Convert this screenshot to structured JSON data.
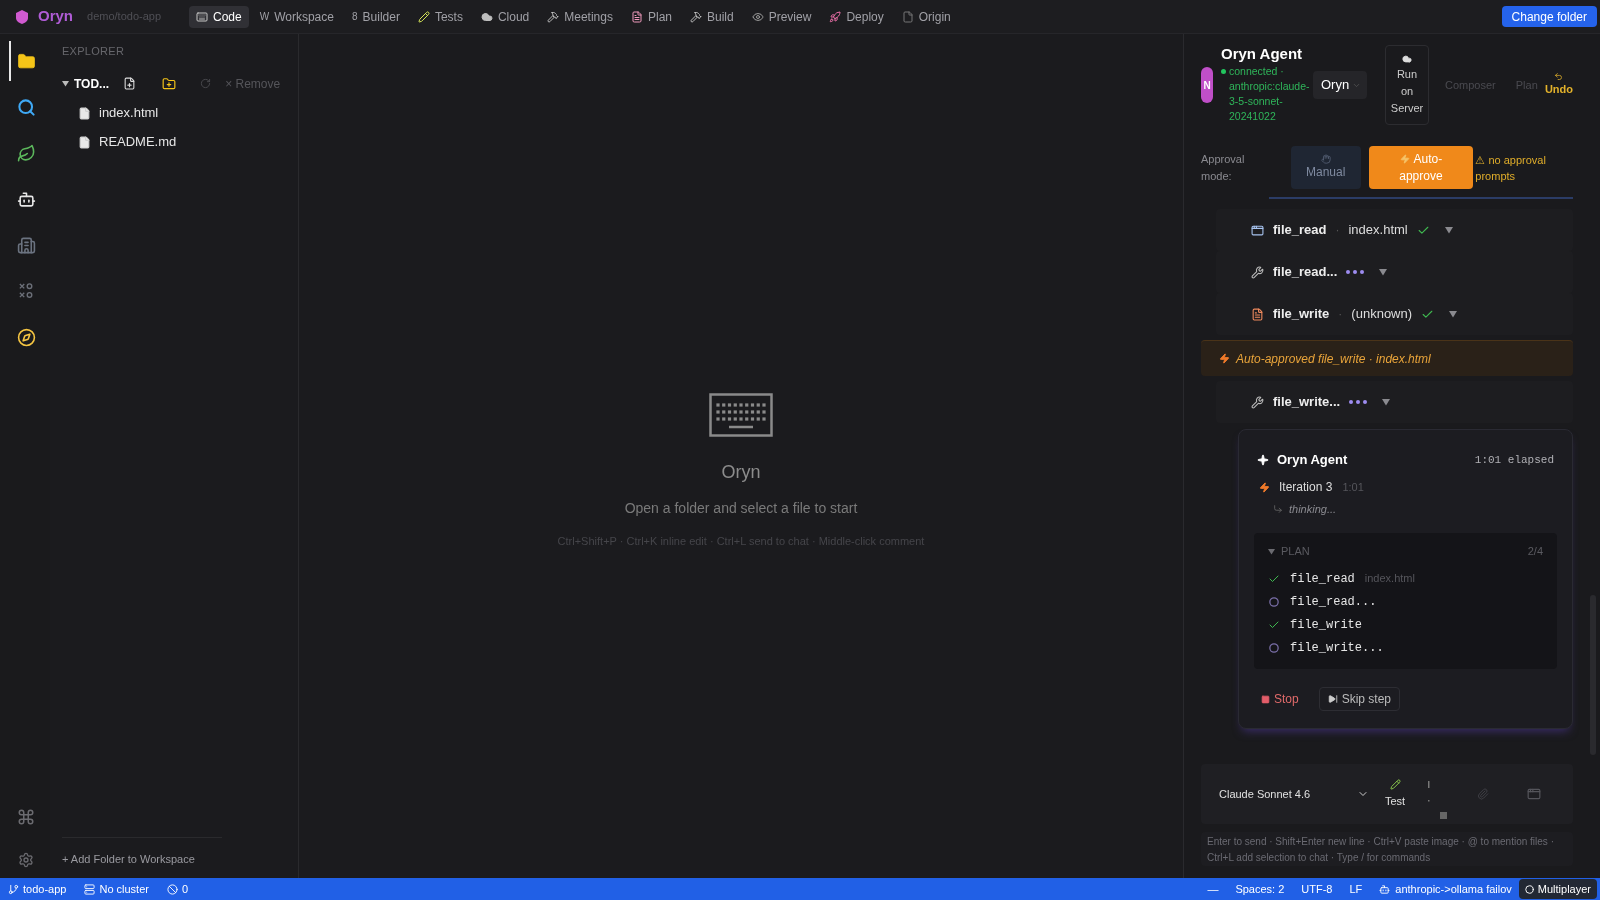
{
  "top_bar": {
    "app_name": "Oryn",
    "project_path": "demo/todo-app",
    "tabs": [
      {
        "label": "Code",
        "selected": true
      },
      {
        "glyph": "W",
        "label": "Workspace",
        "selected": false
      },
      {
        "glyph": "8",
        "label": "Builder",
        "selected": false
      },
      {
        "label": "Tests",
        "selected": false
      },
      {
        "label": "Cloud",
        "selected": false
      },
      {
        "label": "Meetings",
        "selected": false
      },
      {
        "label": "Plan",
        "selected": false
      },
      {
        "label": "Build",
        "selected": false
      },
      {
        "label": "Preview",
        "selected": false
      },
      {
        "label": "Deploy",
        "selected": false
      },
      {
        "label": "Origin",
        "selected": false
      }
    ],
    "change_folder_button": "Change folder"
  },
  "activity_bar": {
    "items": [
      {
        "selected": true
      },
      {
        "selected": false
      },
      {
        "selected": false
      },
      {
        "selected": false
      },
      {
        "selected": false
      },
      {
        "selected": false
      },
      {
        "selected": false
      }
    ]
  },
  "explorer": {
    "title": "EXPLORER",
    "folder": {
      "name": "TOD...",
      "expanded": true,
      "remove_label": "× Remove"
    },
    "files": [
      {
        "name": "index.html"
      },
      {
        "name": "README.md"
      }
    ],
    "add_folder": "+ Add Folder to Workspace"
  },
  "editor": {
    "title": "Oryn",
    "message": "Open a folder and select a file to start",
    "shortcuts": "Ctrl+Shift+P · Ctrl+K inline edit · Ctrl+L send to chat · Middle-click comment"
  },
  "agent_panel": {
    "avatar_letter": "N",
    "title": "Oryn Agent",
    "connected": true,
    "status": "connected · anthropic:claude-3-5-sonnet-20241022",
    "agent_select": "Oryn",
    "run_button": "Run on Server",
    "mode_tabs": [
      {
        "label": "Composer",
        "selected": false
      },
      {
        "label": "Plan",
        "selected": false
      }
    ],
    "undo_button": "Undo",
    "approval": {
      "label": "Approval mode:",
      "options": [
        {
          "label": "Manual",
          "selected": false
        },
        {
          "label": "Auto-approve",
          "selected": true
        }
      ],
      "warning": "⚠ no approval prompts"
    },
    "activity": [
      {
        "kind": "call",
        "name": "file_read",
        "separator": "·",
        "target": "index.html",
        "done": true
      },
      {
        "kind": "call",
        "name": "file_read...",
        "done": false
      },
      {
        "kind": "call",
        "name": "file_write",
        "separator": "·",
        "target": "(unknown)",
        "done": true
      },
      {
        "kind": "notice",
        "text": "Auto-approved file_write · index.html"
      },
      {
        "kind": "call",
        "name": "file_write...",
        "done": false
      }
    ],
    "run": {
      "title": "Oryn Agent",
      "elapsed": "1:01 elapsed",
      "iteration": "Iteration 3",
      "iteration_time": "1:01",
      "thinking": "thinking...",
      "plan": {
        "title": "PLAN",
        "expanded": true,
        "progress": "2/4",
        "steps": [
          {
            "name": "file_read",
            "detail": "index.html",
            "done": true
          },
          {
            "name": "file_read...",
            "done": false
          },
          {
            "name": "file_write",
            "done": true
          },
          {
            "name": "file_write...",
            "done": false
          }
        ]
      },
      "stop_button": "Stop",
      "skip_button": "Skip step"
    },
    "composer": {
      "model": "Claude Sonnet 4.6",
      "test_button": "Test",
      "placeholder": "Enter to send · Shift+Enter new line · Ctrl+V paste image · @ to mention files · Ctrl+L add selection to chat · Type / for commands"
    }
  },
  "status_bar": {
    "left": [
      {
        "text": "todo-app"
      },
      {
        "text": "No cluster"
      },
      {
        "text": "0"
      }
    ],
    "right": [
      {
        "text": "—"
      },
      {
        "text": "Spaces: 2"
      },
      {
        "text": "UTF-8"
      },
      {
        "text": "LF"
      },
      {
        "text": "anthropic->ollama failov"
      }
    ],
    "multiplayer_button": "Multiplayer"
  }
}
